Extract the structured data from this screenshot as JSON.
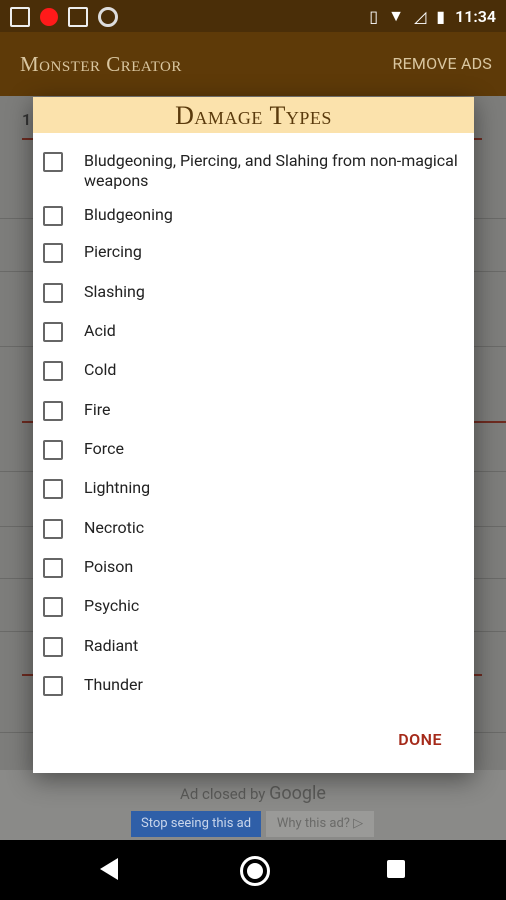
{
  "status_bar": {
    "time": "11:34"
  },
  "app_bar": {
    "title": "Monster Creator",
    "action": "REMOVE ADS"
  },
  "background": {
    "fragment": "1"
  },
  "dialog": {
    "title": "Damage Types",
    "options": [
      {
        "label": "Bludgeoning, Piercing, and Slahing from non-magical weapons",
        "checked": false
      },
      {
        "label": "Bludgeoning",
        "checked": false
      },
      {
        "label": "Piercing",
        "checked": false
      },
      {
        "label": "Slashing",
        "checked": false
      },
      {
        "label": "Acid",
        "checked": false
      },
      {
        "label": "Cold",
        "checked": false
      },
      {
        "label": "Fire",
        "checked": false
      },
      {
        "label": "Force",
        "checked": false
      },
      {
        "label": "Lightning",
        "checked": false
      },
      {
        "label": "Necrotic",
        "checked": false
      },
      {
        "label": "Poison",
        "checked": false
      },
      {
        "label": "Psychic",
        "checked": false
      },
      {
        "label": "Radiant",
        "checked": false
      },
      {
        "label": "Thunder",
        "checked": false
      }
    ],
    "done_label": "DONE"
  },
  "ad": {
    "closed_prefix": "Ad closed by",
    "closed_brand": "Google",
    "stop_label": "Stop seeing this ad",
    "why_label": "Why this ad? ▷"
  }
}
